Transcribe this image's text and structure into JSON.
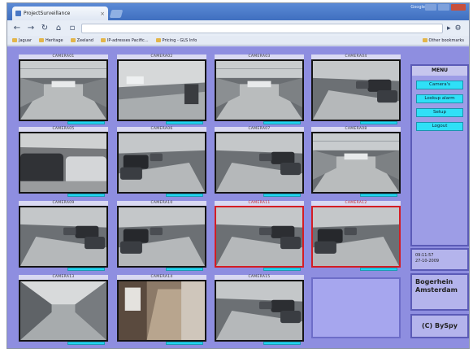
{
  "browser": {
    "tab_title": "ProjectSurveillance",
    "user_link": "Google",
    "address_placeholder": "",
    "bookmarks": [
      {
        "label": "Jaguar"
      },
      {
        "label": "Heritage"
      },
      {
        "label": "Zeeland"
      },
      {
        "label": "IP-adresses Pacific..."
      },
      {
        "label": "Pricing - GLS Info"
      },
      {
        "label": "Other bookmarks"
      }
    ]
  },
  "colors": {
    "page_background": "#8e8ee0",
    "status_bar": "#1fd4f0",
    "alert_border": "#d41d24",
    "menu_button": "#2fe0f7"
  },
  "cameras": [
    {
      "label": "CAMERA01",
      "alert": false,
      "scene": "garage"
    },
    {
      "label": "CAMERA02",
      "alert": false,
      "scene": "ramp"
    },
    {
      "label": "CAMERA03",
      "alert": false,
      "scene": "garage"
    },
    {
      "label": "CAMERA04",
      "alert": false,
      "scene": "cars-right"
    },
    {
      "label": "CAMERA05",
      "alert": false,
      "scene": "cars-close"
    },
    {
      "label": "CAMERA06",
      "alert": false,
      "scene": "cars-left"
    },
    {
      "label": "CAMERA07",
      "alert": false,
      "scene": "cars-right"
    },
    {
      "label": "CAMERA08",
      "alert": false,
      "scene": "garage"
    },
    {
      "label": "CAMERA09",
      "alert": false,
      "scene": "cars-right"
    },
    {
      "label": "CAMERA10",
      "alert": false,
      "scene": "cars-left"
    },
    {
      "label": "CAMERA11",
      "alert": true,
      "scene": "cars-right"
    },
    {
      "label": "CAMERA12",
      "alert": true,
      "scene": "cars-left"
    },
    {
      "label": "CAMERA13",
      "alert": false,
      "scene": "corridor"
    },
    {
      "label": "CAMERA14",
      "alert": false,
      "scene": "hallway"
    },
    {
      "label": "CAMERA15",
      "alert": false,
      "scene": "cars-right"
    }
  ],
  "menu": {
    "title": "MENU",
    "items": [
      "Camera's",
      "Lookup alarm",
      "Setup",
      "Logout"
    ]
  },
  "datetime": {
    "time": "09:11:57",
    "date": "27-10-2009"
  },
  "location": {
    "line1": "Bogerhein",
    "line2": "Amsterdam"
  },
  "copyright": "(C) BySpy"
}
